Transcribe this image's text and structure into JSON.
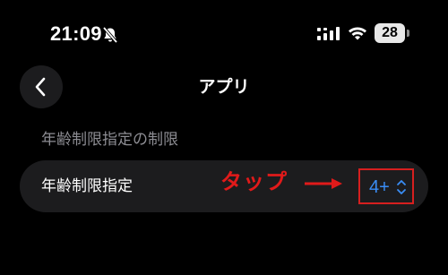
{
  "status_bar": {
    "time": "21:09",
    "battery": "28",
    "icons": [
      "bell-muted-icon",
      "cellular-signal-icon",
      "wifi-icon",
      "battery-icon"
    ]
  },
  "nav": {
    "title": "アプリ",
    "back_icon": "chevron-left-icon"
  },
  "section": {
    "header": "年齢制限指定の制限",
    "row": {
      "label": "年齢制限指定",
      "value": "4+",
      "value_icon": "chevron-up-down-icon"
    }
  },
  "annotation": {
    "text": "タップ",
    "arrow_icon": "arrow-right-icon",
    "color": "#e01a1a"
  },
  "colors": {
    "background": "#000000",
    "cell": "#1c1c1e",
    "secondary_text": "#8d8d93",
    "accent": "#3a8df5",
    "highlight_border": "#d61f1f"
  }
}
